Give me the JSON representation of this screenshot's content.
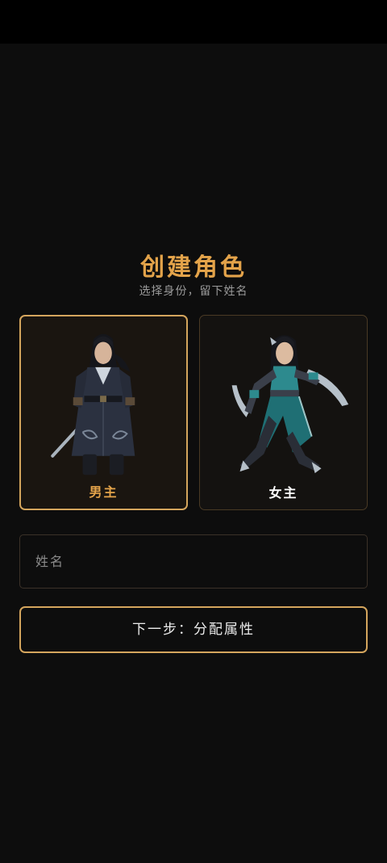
{
  "screen": {
    "title": "创建角色",
    "subtitle": "选择身份，留下姓名"
  },
  "characters": [
    {
      "label": "男主",
      "selected": true,
      "label_color": "#e3a34a",
      "portrait": "male-swordsman-icon"
    },
    {
      "label": "女主",
      "selected": false,
      "label_color": "#ffffff",
      "portrait": "female-blade-dancer-icon"
    }
  ],
  "name_field": {
    "placeholder": "姓名",
    "value": ""
  },
  "next_button": {
    "label": "下一步：分配属性"
  },
  "colors": {
    "background": "#0d0d0d",
    "accent_gold": "#d4a55d",
    "title_gold": "#e3a34a",
    "teal_accent": "#2d8a8e"
  }
}
